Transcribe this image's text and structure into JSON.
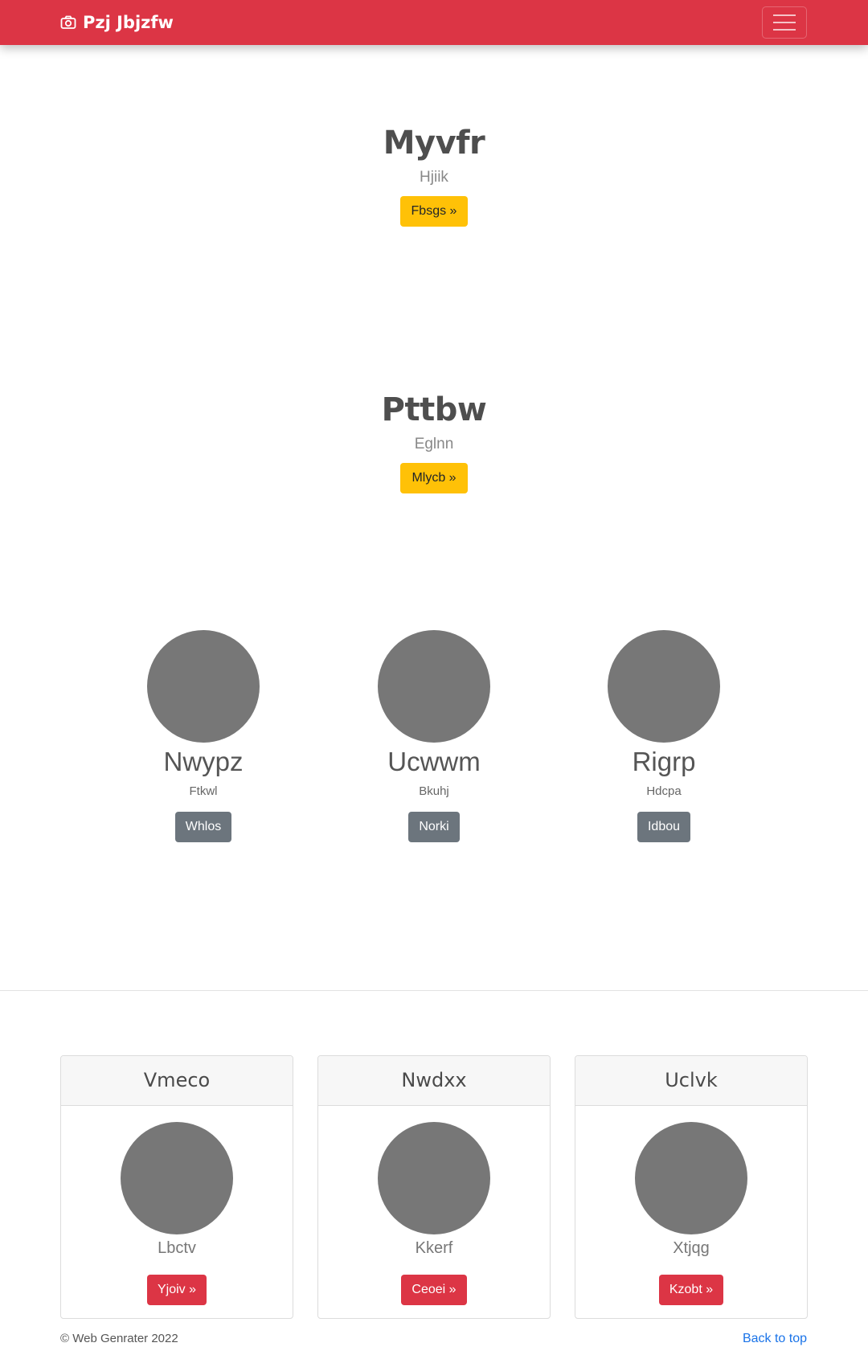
{
  "navbar": {
    "brand": "Pzj Jbjzfw",
    "brand_icon": "camera-icon",
    "toggle_icon": "hamburger-menu-icon",
    "color": "#dc3545"
  },
  "hero1": {
    "title": "Myvfr",
    "subtitle": "Hjiik",
    "button": "Fbsgs »"
  },
  "hero2": {
    "title": "Pttbw",
    "subtitle": "Eglnn",
    "button": "Mlycb »"
  },
  "people": [
    {
      "name": "Nwypz",
      "subtitle": "Ftkwl",
      "button": "Whlos"
    },
    {
      "name": "Ucwwm",
      "subtitle": "Bkuhj",
      "button": "Norki"
    },
    {
      "name": "Rigrp",
      "subtitle": "Hdcpa",
      "button": "Idbou"
    }
  ],
  "cards": [
    {
      "header": "Vmeco",
      "name": "Lbctv",
      "button": "Yjoiv »"
    },
    {
      "header": "Nwdxx",
      "name": "Kkerf",
      "button": "Ceoei »"
    },
    {
      "header": "Uclvk",
      "name": "Xtjqg",
      "button": "Kzobt »"
    }
  ],
  "footer": {
    "copyright": "© Web Genrater 2022",
    "back_to_top": "Back to top"
  },
  "colors": {
    "warning": "#ffc107",
    "secondary": "#6c757d",
    "danger": "#dc3545",
    "link": "#1a73e8",
    "avatar": "#777777"
  }
}
